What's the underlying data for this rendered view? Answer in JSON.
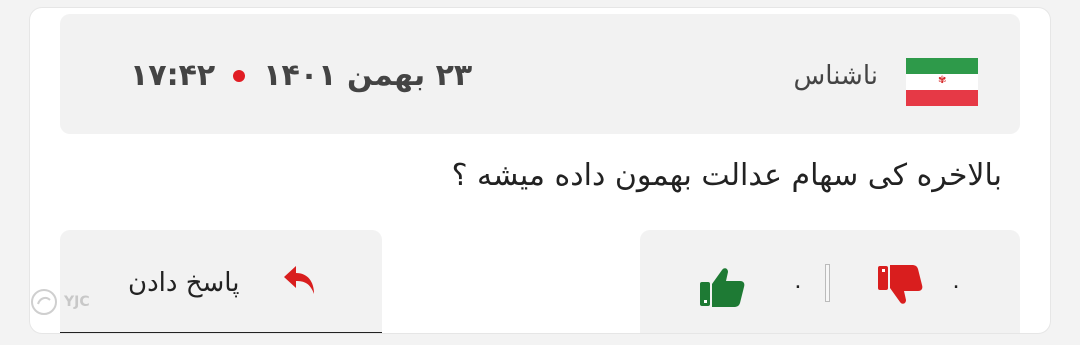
{
  "comment": {
    "author": "ناشناس",
    "date": "۲۳ بهمن ۱۴۰۱",
    "time": "۱۷:۴۲",
    "text": "بالاخره کی سهام عدالت بهمون داده میشه ؟"
  },
  "votes": {
    "likes": "۰",
    "dislikes": "۰",
    "like_color": "#1e7a34",
    "dislike_color": "#d91e1e"
  },
  "reply": {
    "label": "پاسخ دادن"
  },
  "watermark": {
    "text": "YJC"
  },
  "icons": {
    "flag": "iran-flag-icon",
    "like": "thumbs-up-icon",
    "dislike": "thumbs-down-icon",
    "reply": "reply-arrow-icon"
  }
}
